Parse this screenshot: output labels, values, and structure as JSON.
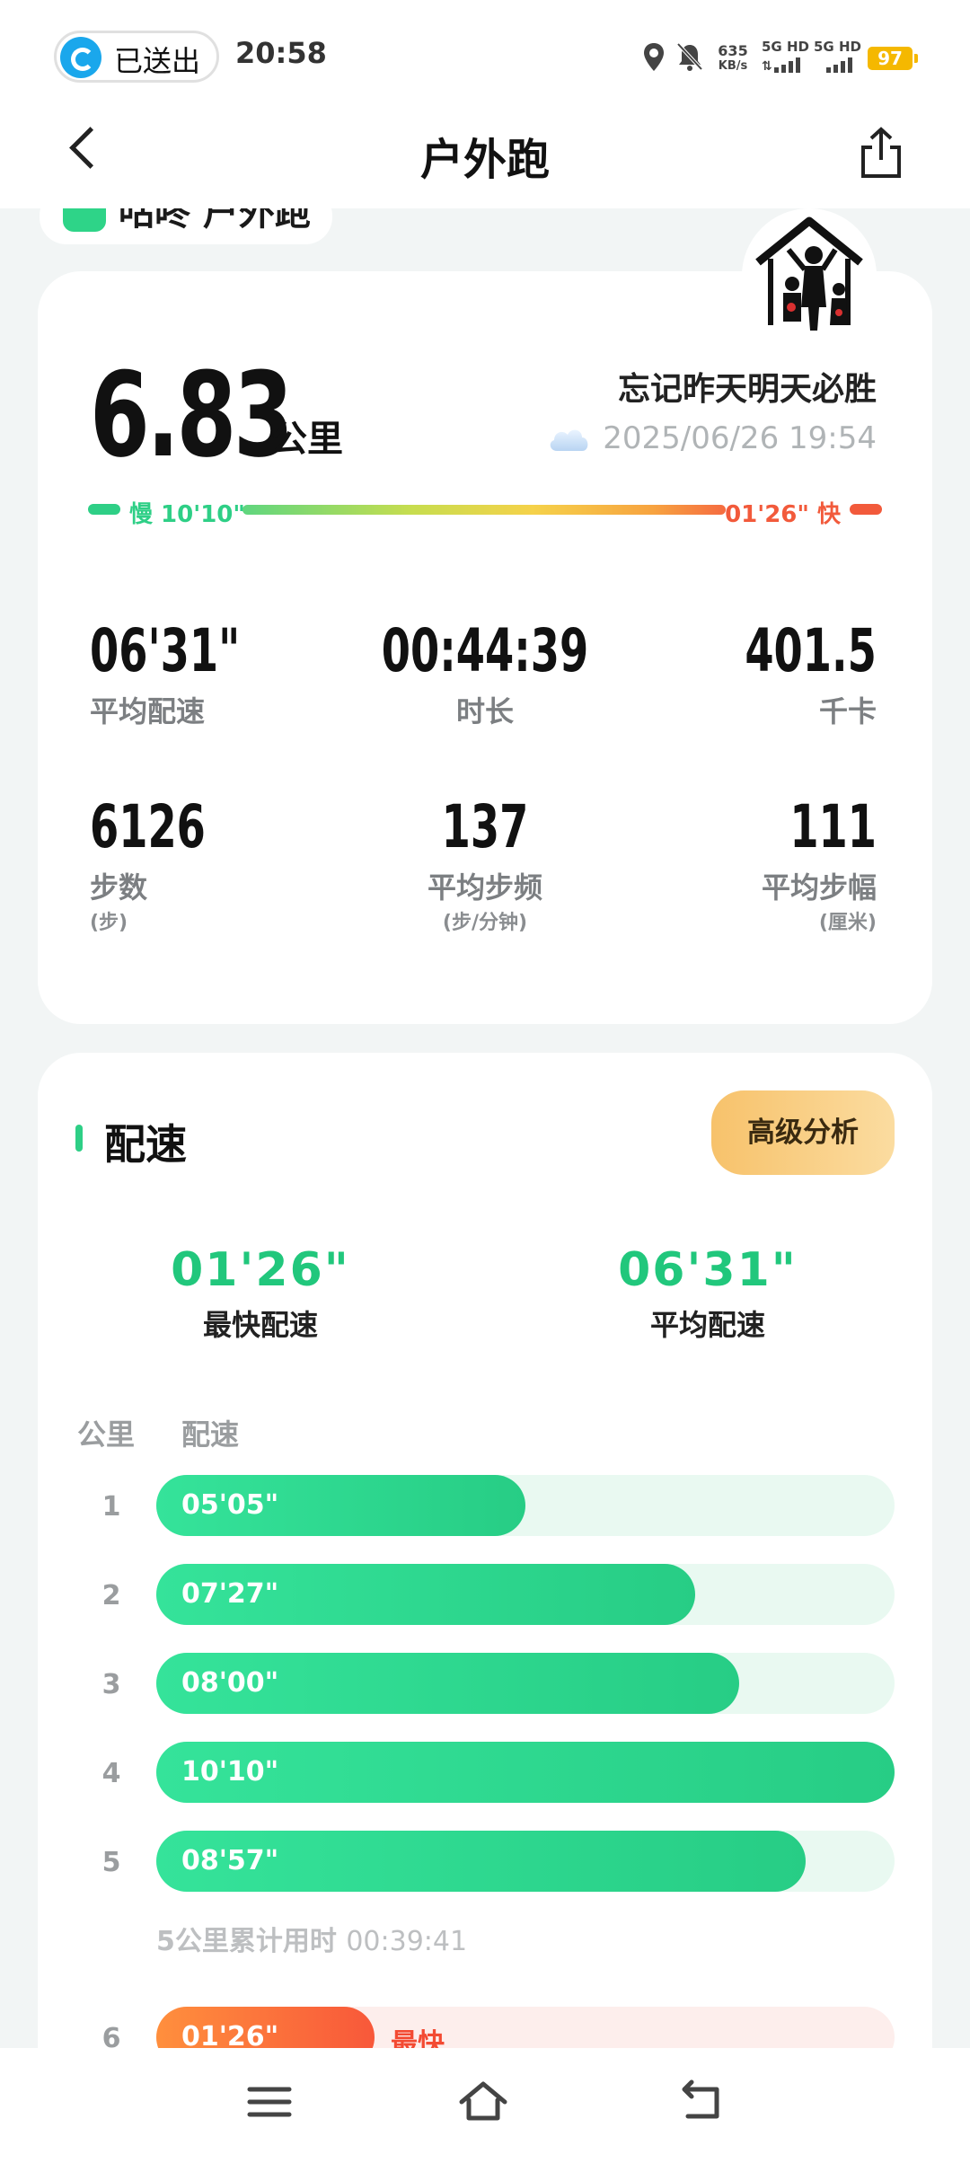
{
  "status_bar": {
    "sent_label": "已送出",
    "time": "20:58",
    "net_speed_value": "635",
    "net_speed_unit": "KB/s",
    "signal1": "5G HD",
    "signal2": "5G HD",
    "battery": "97",
    "icons": [
      "location-icon",
      "mute-icon"
    ]
  },
  "header": {
    "title": "户外跑",
    "back_icon": "chevron-left-icon",
    "share_icon": "share-icon"
  },
  "brand": {
    "name": "咕咚 户外跑"
  },
  "summary": {
    "distance": "6.83",
    "distance_unit": "公里",
    "motto": "忘记昨天明天必胜",
    "datetime": "2025/06/26 19:54",
    "weather_icon": "cloud-icon",
    "pace_scale": {
      "slow_label": "慢 10'10\"",
      "fast_label": "01'26\" 快"
    },
    "stats": [
      {
        "value": "06'31\"",
        "label": "平均配速",
        "sub": ""
      },
      {
        "value": "00:44:39",
        "label": "时长",
        "sub": ""
      },
      {
        "value": "401.5",
        "label": "千卡",
        "sub": ""
      },
      {
        "value": "6126",
        "label": "步数",
        "sub": "(步)"
      },
      {
        "value": "137",
        "label": "平均步频",
        "sub": "(步/分钟)"
      },
      {
        "value": "111",
        "label": "平均步幅",
        "sub": "(厘米)"
      }
    ]
  },
  "pace_section": {
    "title": "配速",
    "advanced_button": "高级分析",
    "fastest_value": "01'26\"",
    "fastest_label": "最快配速",
    "average_value": "06'31\"",
    "average_label": "平均配速",
    "col_km": "公里",
    "col_pace": "配速",
    "rows": [
      {
        "km": "1",
        "pace": "05'05\"",
        "fraction": 0.5
      },
      {
        "km": "2",
        "pace": "07'27\"",
        "fraction": 0.73
      },
      {
        "km": "3",
        "pace": "08'00\"",
        "fraction": 0.79
      },
      {
        "km": "4",
        "pace": "10'10\"",
        "fraction": 1.0
      },
      {
        "km": "5",
        "pace": "08'57\"",
        "fraction": 0.88
      }
    ],
    "cumulative_label": "5公里累计用时",
    "cumulative_time": "00:39:41",
    "fast_row": {
      "km": "6",
      "pace": "01'26\"",
      "tag": "最快",
      "fraction": 0.3
    }
  },
  "colors": {
    "accent_green": "#21c77c",
    "accent_orange": "#f8583a",
    "button_gold": "#f7c26b"
  },
  "nav": {
    "icons": [
      "menu-icon",
      "home-icon",
      "back-icon"
    ]
  }
}
